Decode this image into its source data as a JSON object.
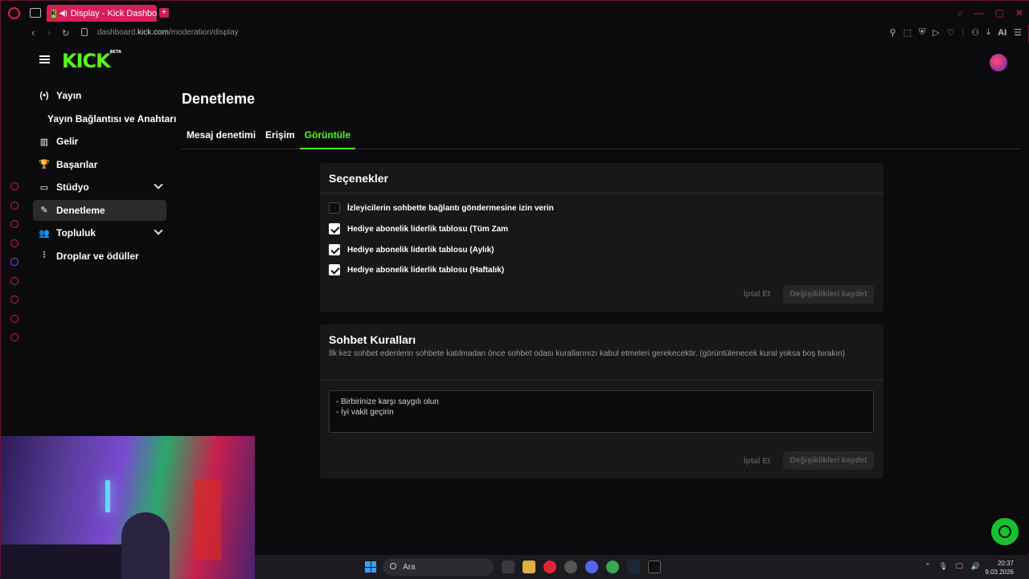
{
  "browser": {
    "tab_title": "Display - Kick Dashboard",
    "tab_favicon": "K",
    "url_prefix": "dashboard.",
    "url_domain": "kick.com",
    "url_path": "/moderation/display",
    "toolbar_ai": "AI"
  },
  "brand": {
    "logo": "KICK",
    "beta": "BETA"
  },
  "sidebar": {
    "items": [
      {
        "label": "Yayın",
        "icon": "(•)"
      },
      {
        "label": "Yayın Bağlantısı ve Anahtarı"
      },
      {
        "label": "Gelir",
        "icon": "▥"
      },
      {
        "label": "Başarılar",
        "icon": "🏆"
      },
      {
        "label": "Stüdyo",
        "icon": "▭"
      },
      {
        "label": "Denetleme",
        "icon": "✎"
      },
      {
        "label": "Topluluk",
        "icon": "👥"
      },
      {
        "label": "Droplar ve ödüller",
        "icon": "⫶"
      }
    ]
  },
  "main": {
    "title": "Denetleme",
    "tabs": [
      {
        "label": "Mesaj denetimi"
      },
      {
        "label": "Erişim"
      },
      {
        "label": "Görüntüle"
      }
    ]
  },
  "options_card": {
    "title": "Seçenekler",
    "options": [
      {
        "label": "İzleyicilerin sohbette bağlantı göndermesine izin verin",
        "checked": false
      },
      {
        "label": "Hediye abonelik liderlik tablosu (Tüm Zam",
        "checked": true
      },
      {
        "label": "Hediye abonelik liderlik tablosu (Aylık)",
        "checked": true
      },
      {
        "label": "Hediye abonelik liderlik tablosu (Haftalık)",
        "checked": true
      }
    ],
    "cancel": "İptal Et",
    "save": "Değişiklikleri kaydet"
  },
  "rules_card": {
    "title": "Sohbet Kuralları",
    "description": "İlk kez sohbet edenlerin sohbete katılmadan önce sohbet odası kurallarınızı kabul etmeleri gerekecektir. (görüntülenecek kural yoksa boş bırakın)",
    "rules_text": "- Birbirinize karşı saygılı olun\n- İyi vakit geçirin",
    "cancel": "İptal Et",
    "save": "Değişiklikleri kaydet"
  },
  "taskbar": {
    "search_placeholder": "Ara",
    "time": "20:37",
    "date": "9.03.2026"
  },
  "colors": {
    "accent": "#53fc18",
    "opera_red": "#e3243b",
    "tab_pink": "#d51f5a",
    "support_green": "#18c22e"
  }
}
